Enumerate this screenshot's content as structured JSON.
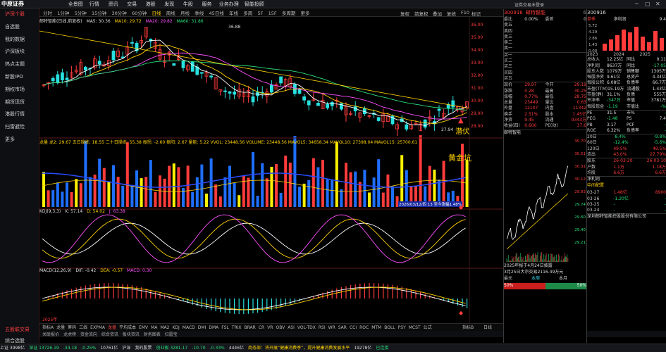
{
  "app": {
    "logo": "中原证券",
    "menu": [
      "全景图",
      "行情",
      "资讯",
      "交易",
      "港股",
      "发现",
      "牛股",
      "服务",
      "业务办理",
      "智能投顾"
    ],
    "account": "证券交易未登录",
    "window": [
      "−",
      "▢",
      "✕"
    ]
  },
  "sidebar": {
    "items": [
      "沪深个股",
      "自选股",
      "我的数据",
      "沪深板块",
      "热点主题",
      "新股IPO",
      "期权市场",
      "期货现货",
      "港股行情",
      "扫雷避险",
      "更多"
    ],
    "bottom": "五股联交易",
    "bottom2": "综合选股"
  },
  "periods": {
    "items": [
      "分时",
      "1分钟",
      "5分钟",
      "15分钟",
      "30分钟",
      "60分钟",
      "日线",
      "周线",
      "月线",
      "季线",
      "45日线",
      "年线",
      "多周",
      "5F",
      "15F",
      "多周期",
      "更多"
    ],
    "selected": "日线",
    "right": [
      "复权",
      "前复权",
      "叠加",
      "复统",
      "F10",
      "标记"
    ]
  },
  "main_chart": {
    "title": "邮特智能(日线,前复权)",
    "ma": [
      {
        "label": "MA5: 30.36",
        "color": "#ffffff"
      },
      {
        "label": "MA10: 29.72",
        "color": "#ffd200"
      },
      {
        "label": "MA20: 29.82",
        "color": "#ff50ff"
      },
      {
        "label": "MA60: 31.86",
        "color": "#28e07a"
      }
    ],
    "high_label": "36.88",
    "low_label": "27.94",
    "annotation": "潜伏",
    "y_ticks": [
      "36.00",
      "35.00",
      "34.00",
      "33.00",
      "32.00",
      "31.00",
      "30.00",
      "29.00",
      "28.00"
    ]
  },
  "volume_panel": {
    "indicators": "龙量 龙2: 29.67 五日操练: 18.55 二十日操练: 55.38 振拐: -2.60 振阳: 2.67 量能: 5.22 VVOL: 23448.56 VOLUME: 23448.56 MAVOL5: 34658.34 MAVOL10: 27398.04 MAVOL15: 25700.61",
    "annotation": "黄金坑",
    "date_badge": "2026/03/12/四 13 至今涨幅1.48%"
  },
  "kdj_panel": {
    "label": "KDJ(9,3,3)",
    "k": "K: 57.14",
    "d": "D: 54.02",
    "j": "J: 63.38"
  },
  "macd_panel": {
    "label": "MACD(12,26,9)",
    "dif": "DIF: -0.42",
    "dea": "DEA: -0.57",
    "macd": "MACD: 0.30",
    "start": "2025年"
  },
  "bottom_bar": {
    "items": [
      "指标A",
      "龙量",
      "筹码",
      "三线",
      "EXPMA",
      "龙盘",
      "平均成本",
      "EMV",
      "MA",
      "MA2",
      "KDJ",
      "MACD",
      "DMI",
      "DMA",
      "FSL",
      "TRIX",
      "BRAR",
      "CR",
      "VR",
      "OBV",
      "ASI",
      "VOL-TDX",
      "RSI",
      "WR",
      "SAR",
      "CCI",
      "ROC",
      "MTM",
      "BOLL",
      "PSY",
      "MCST",
      "公式"
    ],
    "selected": "龙盘",
    "right": [
      "指标B",
      "日线"
    ]
  },
  "bottom_tabs": {
    "items": [
      "关联报价",
      "龙虎榜",
      "资金流向",
      "综合资讯",
      "板块资讯",
      "财务图表",
      "扫雷宝"
    ]
  },
  "quote": {
    "code": "300916",
    "name": "邮特智能",
    "stock_tag": "6",
    "order": [
      {
        "k": "委比",
        "v": "0.00%",
        "k2": "委差",
        "v2": "0"
      }
    ],
    "asks": [
      "卖五",
      "卖四",
      "卖三",
      "卖二",
      "卖一"
    ],
    "bids": [
      "买一",
      "买二",
      "买三",
      "买四",
      "买五"
    ],
    "stats": [
      [
        "现价",
        "29.97",
        "今开",
        "29.19"
      ],
      [
        "涨跌",
        "0.28",
        "最高",
        "30.25"
      ],
      [
        "涨幅",
        "0.77%",
        "最低",
        "28.75"
      ],
      [
        "总量",
        "23449",
        "量比",
        "0.63"
      ],
      [
        "外盘",
        "12107",
        "内盘",
        "11342"
      ],
      [
        "换手",
        "2.51%",
        "股本",
        "1.45亿"
      ],
      [
        "净资",
        "9.45",
        "流通",
        "9343万"
      ],
      [
        "收益(四)",
        "0.600",
        "PE(动)",
        "37.6"
      ]
    ],
    "chart_title": "邮特智能",
    "chart_y": [
      "30.70",
      "30.51",
      "30.31",
      "30.12",
      "29.93",
      "29.74",
      "29.60",
      "29.40",
      "29.21"
    ],
    "bottom_text": "2025年报于4月24日披露",
    "bottom_text2": "3月25日大宗交易2116.49万元",
    "fee": [
      "最元",
      "本周",
      "本月"
    ],
    "fee_bar": [
      "50%",
      "50%"
    ]
  },
  "fin": {
    "code": "300916",
    "tabs": [
      "单季",
      "净利润",
      "9.4"
    ],
    "chart_title": "净利润(亿)",
    "bars_y": [
      "5.72",
      "4.29",
      "2.86",
      "1.43",
      "0.00"
    ],
    "years": [
      "2023",
      "2024",
      "2025"
    ],
    "rows": [
      [
        "总收入",
        "12.25亿",
        "同比",
        "0.11"
      ],
      [
        "净利润",
        "8637万",
        "同比",
        "-17.05"
      ],
      [
        "股东人数",
        "1079万",
        "销售额",
        "1305万"
      ],
      [
        "每股净资",
        "9.61亿",
        "总资产",
        "4.34亿"
      ],
      [
        "每股公积",
        "6.08亿",
        "负债率",
        "66.7万"
      ],
      [
        "市盈(TTM)",
        "15.19万",
        "流通股",
        "1.43亿"
      ],
      [
        "市盈(静)",
        "31.1%",
        "负债",
        "555万"
      ],
      [
        "市净率",
        "-347万",
        "市值",
        "3781万"
      ],
      [
        "每股现金",
        "-1.19",
        "市值比",
        "-%"
      ]
    ],
    "pe": [
      [
        "PE",
        "31.5",
        "市%",
        "-"
      ],
      [
        "PEG",
        "-1.48",
        "PS",
        "7.4"
      ],
      [
        "PB",
        "3.17",
        "PCF",
        "-"
      ],
      [
        "ROE",
        "6.32%",
        "负债率",
        "-"
      ]
    ],
    "perf": [
      [
        "20日",
        "-8.4%",
        "-9.8%"
      ],
      [
        "60日",
        "-12.4%",
        "-5.6%"
      ],
      [
        "120日",
        "49.5%",
        "49.5%"
      ],
      [
        "流出",
        "43.0%",
        "27.79%"
      ]
    ],
    "dates": [
      [
        "股东",
        "26-03-20",
        "26-03-10"
      ],
      [
        "户数",
        "1.1万",
        "1.18万"
      ],
      [
        "均股",
        "6.6万",
        "6.6万"
      ]
    ],
    "news": [
      "净利润",
      "中间配置"
    ],
    "dates2": [
      [
        "03-27",
        "1.48亿",
        "8900"
      ],
      [
        "03-26",
        "-1.20亿",
        "-"
      ],
      [
        "03-25",
        "-",
        "-"
      ],
      [
        "03-24",
        "-",
        "-"
      ]
    ],
    "company": "深圳邮特智能控股股份有限公司"
  },
  "status": {
    "items": [
      {
        "t": "上证",
        "v": "3998亿",
        "c": "wh"
      },
      {
        "t": "深证",
        "v": "13726.19",
        "c": "dn"
      },
      {
        "t": "",
        "v": "-34.18",
        "c": "dn"
      },
      {
        "t": "",
        "v": "-0.25%",
        "c": "dn"
      },
      {
        "t": "10761亿",
        "v": "",
        "c": "wh"
      },
      {
        "t": "沪深",
        "v": "",
        "c": "wh"
      },
      {
        "t": "我的股票",
        "v": "",
        "c": "wh"
      },
      {
        "t": "创业板",
        "v": "3281.17",
        "c": "dn"
      },
      {
        "t": "",
        "v": "-10.70",
        "c": "dn"
      },
      {
        "t": "",
        "v": "-0.33%",
        "c": "dn"
      },
      {
        "t": "4446亿",
        "v": "",
        "c": "wh"
      },
      {
        "t": "商务部：将开展“健康消费季”，提升健康消费发展水平",
        "v": "",
        "c": "yl"
      },
      {
        "t": "19278亿",
        "v": "",
        "c": "wh"
      },
      {
        "t": "已连接",
        "v": "",
        "c": "dn"
      }
    ]
  }
}
